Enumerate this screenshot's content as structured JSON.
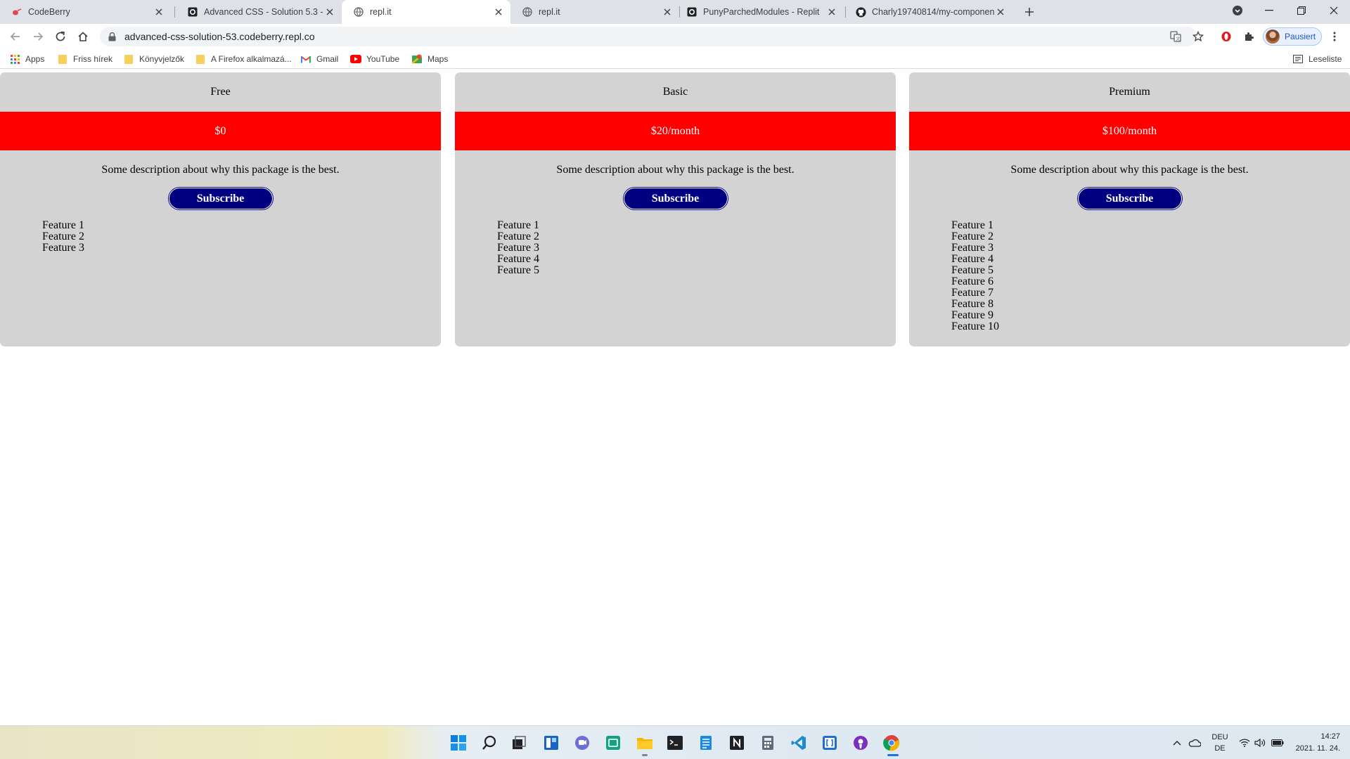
{
  "browser": {
    "tabs": [
      {
        "title": "CodeBerry",
        "icon": "codeberry-icon"
      },
      {
        "title": "Advanced CSS - Solution 5.3 - Re",
        "icon": "replit-icon"
      },
      {
        "title": "repl.it",
        "icon": "globe-icon",
        "active": true
      },
      {
        "title": "repl.it",
        "icon": "globe-icon"
      },
      {
        "title": "PunyParchedModules - Replit",
        "icon": "replit-icon"
      },
      {
        "title": "Charly19740814/my-component",
        "icon": "github-icon"
      }
    ],
    "url": "advanced-css-solution-53.codeberry.repl.co",
    "profile_label": "Pausiert",
    "bookmarks": [
      {
        "label": "Apps",
        "icon": "apps-grid-icon"
      },
      {
        "label": "Friss hírek",
        "icon": "folder-icon"
      },
      {
        "label": "Könyvjelzők",
        "icon": "folder-icon"
      },
      {
        "label": "A Firefox alkalmazá...",
        "icon": "folder-icon"
      },
      {
        "label": "Gmail",
        "icon": "gmail-icon"
      },
      {
        "label": "YouTube",
        "icon": "youtube-icon"
      },
      {
        "label": "Maps",
        "icon": "maps-icon"
      }
    ],
    "reading_list": "Leseliste"
  },
  "pricing": {
    "description": "Some description about why this package is the best.",
    "subscribe_label": "Subscribe",
    "plans": [
      {
        "name": "Free",
        "price": "$0",
        "features": [
          "Feature 1",
          "Feature 2",
          "Feature 3"
        ]
      },
      {
        "name": "Basic",
        "price": "$20/month",
        "features": [
          "Feature 1",
          "Feature 2",
          "Feature 3",
          "Feature 4",
          "Feature 5"
        ]
      },
      {
        "name": "Premium",
        "price": "$100/month",
        "features": [
          "Feature 1",
          "Feature 2",
          "Feature 3",
          "Feature 4",
          "Feature 5",
          "Feature 6",
          "Feature 7",
          "Feature 8",
          "Feature 9",
          "Feature 10"
        ]
      }
    ]
  },
  "taskbar": {
    "lang_top": "DEU",
    "lang_bottom": "DE",
    "time": "14:27",
    "date": "2021. 11. 24."
  }
}
